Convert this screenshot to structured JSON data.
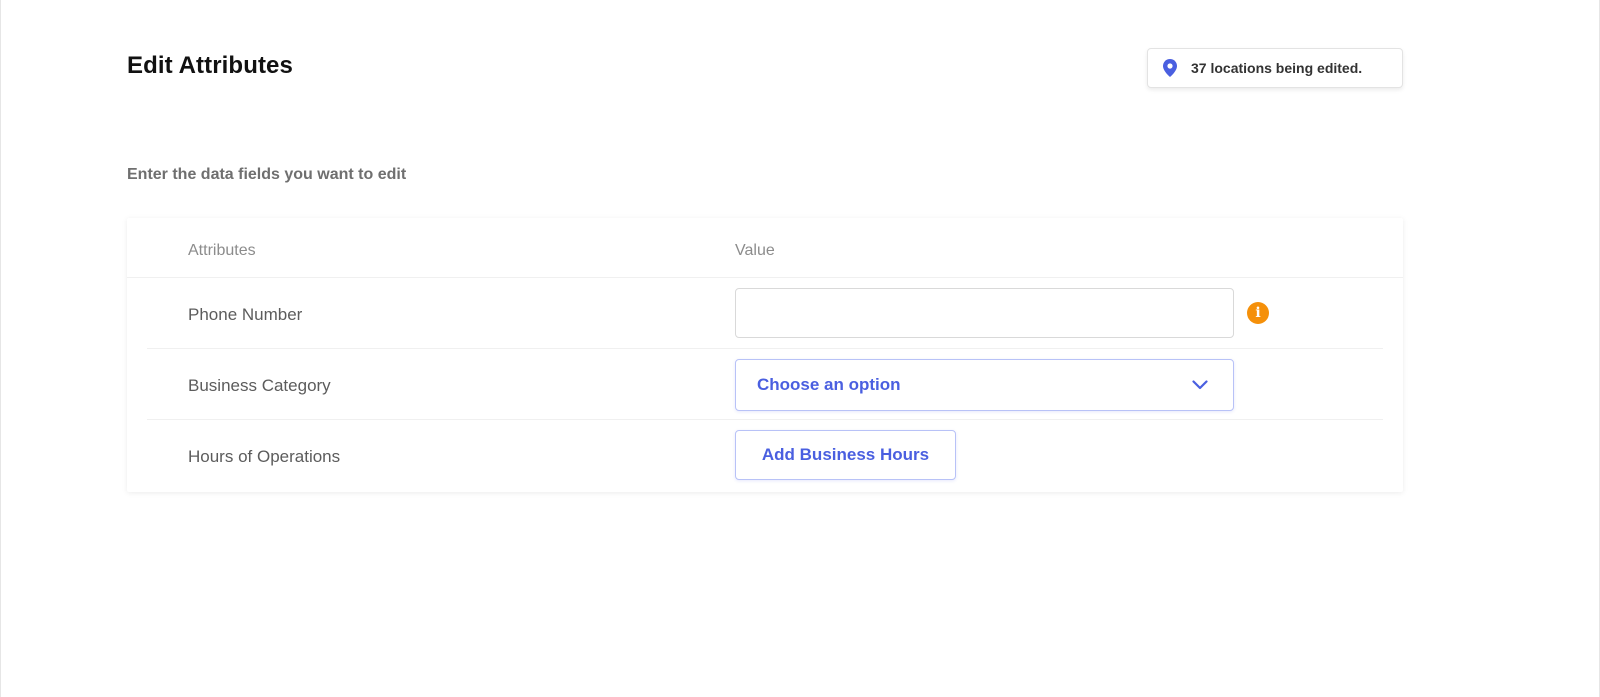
{
  "page": {
    "title": "Edit Attributes",
    "subtitle": "Enter the data fields you want to edit"
  },
  "locations_badge": {
    "icon": "map-pin-icon",
    "text": "37 locations being edited."
  },
  "table": {
    "headers": {
      "attributes": "Attributes",
      "value": "Value"
    },
    "rows": [
      {
        "label": "Phone Number",
        "control": "text-input",
        "value": "",
        "info_icon": "info-icon"
      },
      {
        "label": "Business Category",
        "control": "select",
        "selected": "Choose an option",
        "icon": "chevron-down-icon"
      },
      {
        "label": "Hours of Operations",
        "control": "button",
        "button_label": "Add Business Hours"
      }
    ]
  },
  "colors": {
    "accent": "#4a5fe0",
    "info": "#f5900a",
    "muted_text": "#8c8c8c"
  }
}
